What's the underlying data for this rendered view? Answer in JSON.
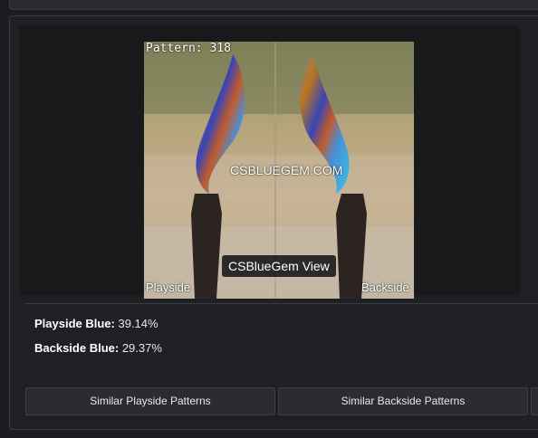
{
  "image": {
    "pattern_label": "Pattern: 318",
    "watermark": "CSBLUEGEM.COM",
    "playside_label": "Playside",
    "backside_label": "Backside",
    "tooltip": "CSBlueGem View"
  },
  "stats": {
    "playside_label": "Playside Blue:",
    "playside_value": " 39.14%",
    "backside_label": "Backside Blue:",
    "backside_value": " 29.37%"
  },
  "buttons": {
    "similar_playside": "Similar Playside Patterns",
    "similar_backside": "Similar Backside Patterns"
  }
}
